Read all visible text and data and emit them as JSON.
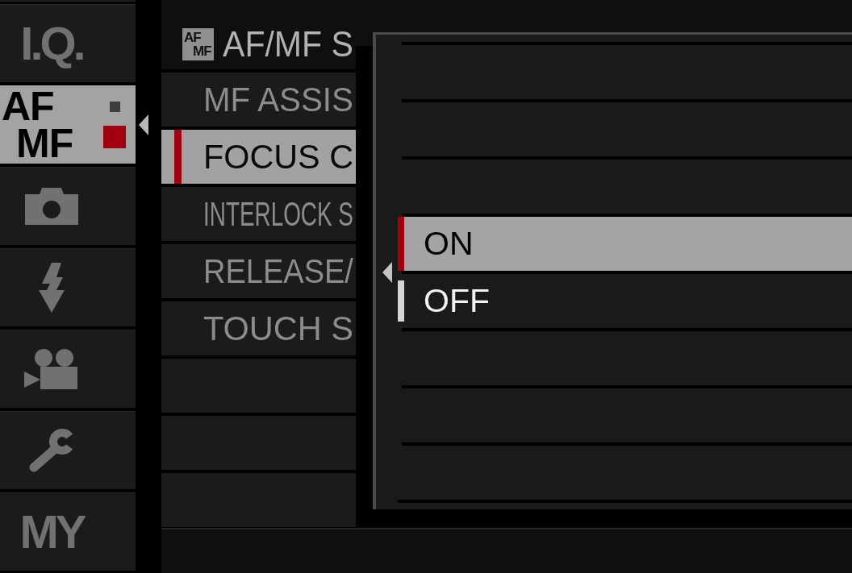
{
  "sidebar": {
    "tabs": [
      {
        "kind": "text",
        "label": "I.Q.",
        "selected": false
      },
      {
        "kind": "text",
        "label": "AF MF",
        "selected": true,
        "pages": [
          {
            "selected": false
          },
          {
            "selected": true
          }
        ]
      },
      {
        "kind": "shooting",
        "selected": false
      },
      {
        "kind": "flash",
        "selected": false
      },
      {
        "kind": "movie",
        "selected": false
      },
      {
        "kind": "setup",
        "selected": false
      },
      {
        "kind": "text",
        "label": "MY",
        "selected": false
      }
    ]
  },
  "header": {
    "badge": "AF MF",
    "title": "AF/MF S"
  },
  "menu": {
    "items": [
      {
        "label": "MF ASSIS",
        "selected": false
      },
      {
        "label": "FOCUS C",
        "selected": true
      },
      {
        "label": "INTERLOCK S",
        "selected": false
      },
      {
        "label": "RELEASE/",
        "selected": false
      },
      {
        "label": "TOUCH S",
        "selected": false
      }
    ]
  },
  "popup": {
    "options": [
      {
        "label": "ON",
        "selected": true,
        "current": false
      },
      {
        "label": "OFF",
        "selected": false,
        "current": true
      }
    ]
  }
}
